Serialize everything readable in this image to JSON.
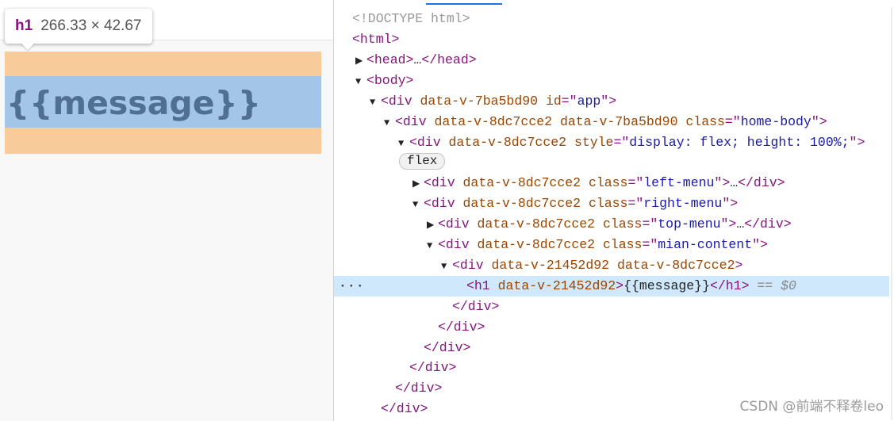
{
  "tooltip": {
    "tag": "h1",
    "dimensions": "266.33 × 42.67"
  },
  "preview": {
    "h1_text": "{{message}}"
  },
  "badge": "flex",
  "selected_suffix": "== $0",
  "dots": "···",
  "watermark": "CSDN @前端不释卷leo",
  "dom_lines": [
    {
      "text": "<!DOCTYPE html>"
    },
    {
      "tag": "html"
    },
    {
      "tag": "head",
      "collapsed": true
    },
    {
      "tag": "body"
    },
    {
      "tag": "div",
      "attrs": [
        [
          "data-v-7ba5bd90",
          null
        ],
        [
          "id",
          "app"
        ]
      ]
    },
    {
      "tag": "div",
      "attrs": [
        [
          "data-v-8dc7cce2",
          null
        ],
        [
          "data-v-7ba5bd90",
          null
        ],
        [
          "class",
          "home-body"
        ]
      ]
    },
    {
      "tag": "div",
      "attrs": [
        [
          "data-v-8dc7cce2",
          null
        ],
        [
          "style",
          "display: flex; height: 100%;"
        ]
      ]
    },
    {
      "tag": "div",
      "attrs": [
        [
          "data-v-8dc7cce2",
          null
        ],
        [
          "class",
          "left-menu"
        ]
      ],
      "collapsed": true
    },
    {
      "tag": "div",
      "attrs": [
        [
          "data-v-8dc7cce2",
          null
        ],
        [
          "class",
          "right-menu"
        ]
      ]
    },
    {
      "tag": "div",
      "attrs": [
        [
          "data-v-8dc7cce2",
          null
        ],
        [
          "class",
          "top-menu"
        ]
      ],
      "collapsed": true
    },
    {
      "tag": "div",
      "attrs": [
        [
          "data-v-8dc7cce2",
          null
        ],
        [
          "class",
          "mian-content"
        ]
      ]
    },
    {
      "tag": "div",
      "attrs": [
        [
          "data-v-21452d92",
          null
        ],
        [
          "data-v-8dc7cce2",
          null
        ]
      ]
    },
    {
      "tag": "h1",
      "attrs": [
        [
          "data-v-21452d92",
          null
        ]
      ],
      "content": "{{message}}"
    },
    {
      "close": "div"
    },
    {
      "close": "div"
    },
    {
      "close": "div"
    },
    {
      "close": "div"
    },
    {
      "close": "div"
    },
    {
      "close": "div"
    }
  ]
}
